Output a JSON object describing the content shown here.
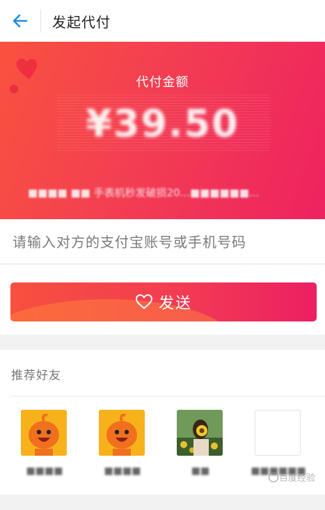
{
  "header": {
    "title": "发起代付",
    "back_icon": "back-arrow-icon"
  },
  "banner": {
    "amount_label": "代付金额",
    "amount_value": "¥39.50",
    "order_desc": "■■■■ ■■ 手表机秒发破损20...■■■■■■..."
  },
  "input": {
    "placeholder": "请输入对方的支付宝账号或手机号码",
    "value": ""
  },
  "send_button": {
    "label": "发送",
    "icon": "heart-outline-icon"
  },
  "friends": {
    "title": "推荐好友",
    "items": [
      {
        "name": "■■■■",
        "avatar": "mascot"
      },
      {
        "name": "■■■■",
        "avatar": "mascot"
      },
      {
        "name": "■■",
        "avatar": "photo"
      },
      {
        "name": "■■■■■■",
        "avatar": "empty"
      }
    ]
  },
  "watermark": "百度经验",
  "colors": {
    "accent": "#f23c52",
    "back_arrow": "#1a8de8"
  }
}
